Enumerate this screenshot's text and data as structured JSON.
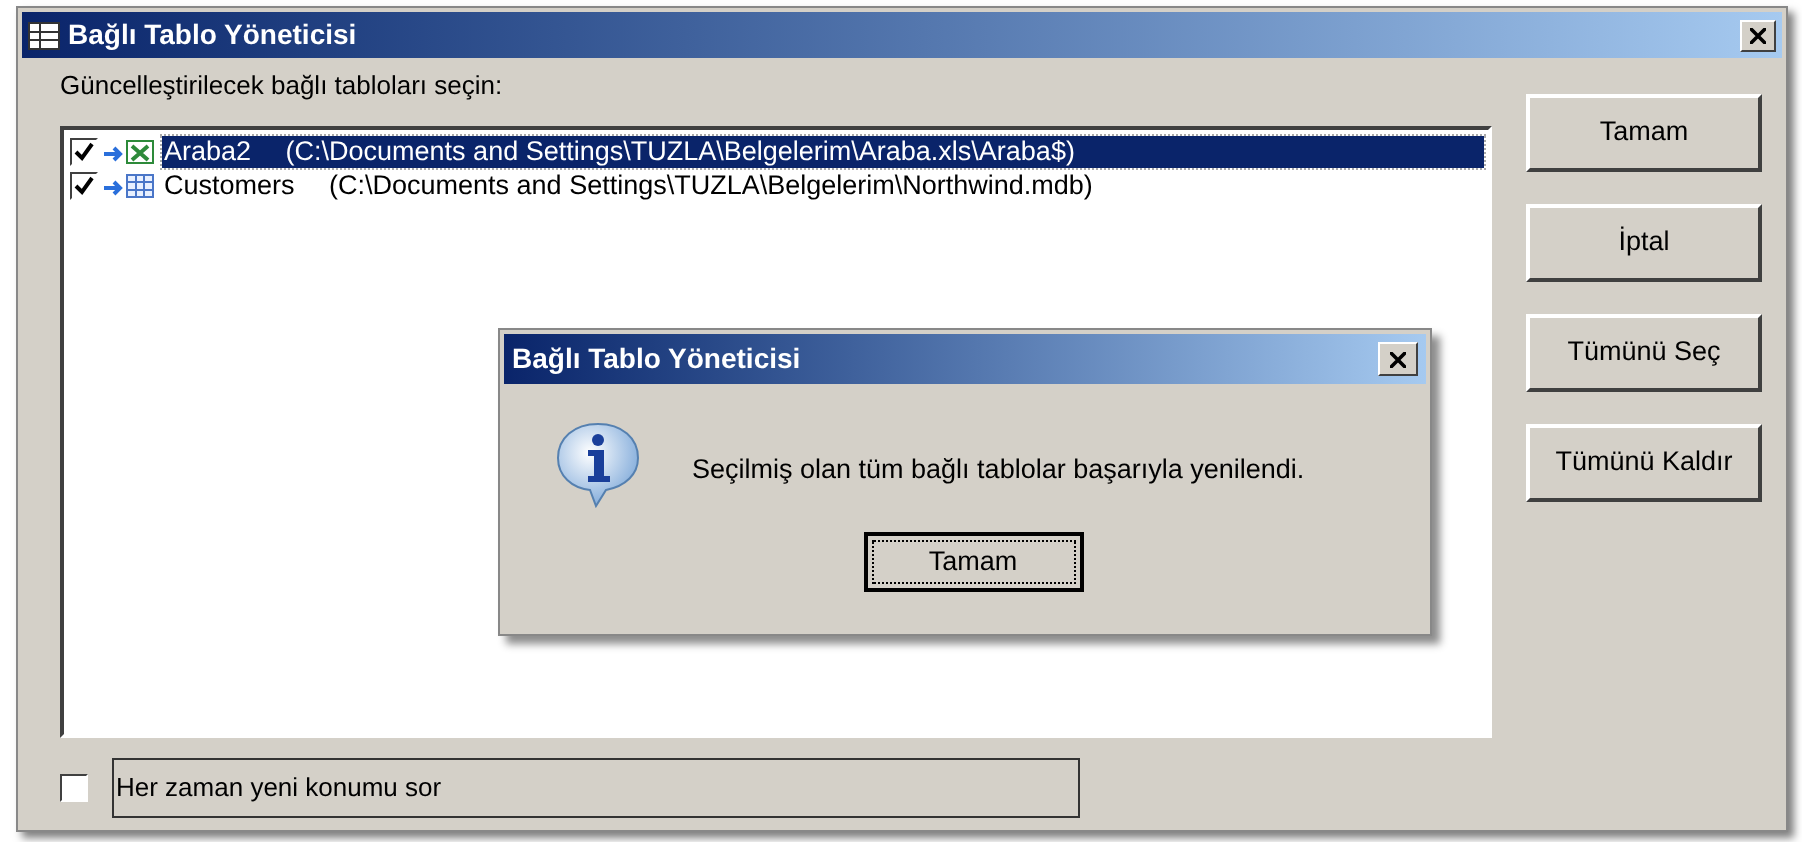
{
  "window": {
    "title": "Bağlı Tablo Yöneticisi"
  },
  "prompt": "Güncelleştirilecek bağlı tabloları seçin:",
  "tables": [
    {
      "kind": "excel",
      "name": "Araba2",
      "path": "(C:\\Documents and Settings\\TUZLA\\Belgelerim\\Araba.xls\\Araba$)",
      "checked": true,
      "selected": true
    },
    {
      "kind": "access",
      "name": "Customers",
      "path": "(C:\\Documents and Settings\\TUZLA\\Belgelerim\\Northwind.mdb)",
      "checked": true,
      "selected": false
    }
  ],
  "buttons": [
    "Tamam",
    "İptal",
    "Tümünü Seç",
    "Tümünü Kaldır"
  ],
  "always_ask": {
    "label": "Her zaman yeni konumu sor",
    "checked": false
  },
  "message_box": {
    "title": "Bağlı Tablo Yöneticisi",
    "message": "Seçilmiş olan tüm bağlı tablolar başarıyla yenilendi.",
    "button": "Tamam"
  }
}
